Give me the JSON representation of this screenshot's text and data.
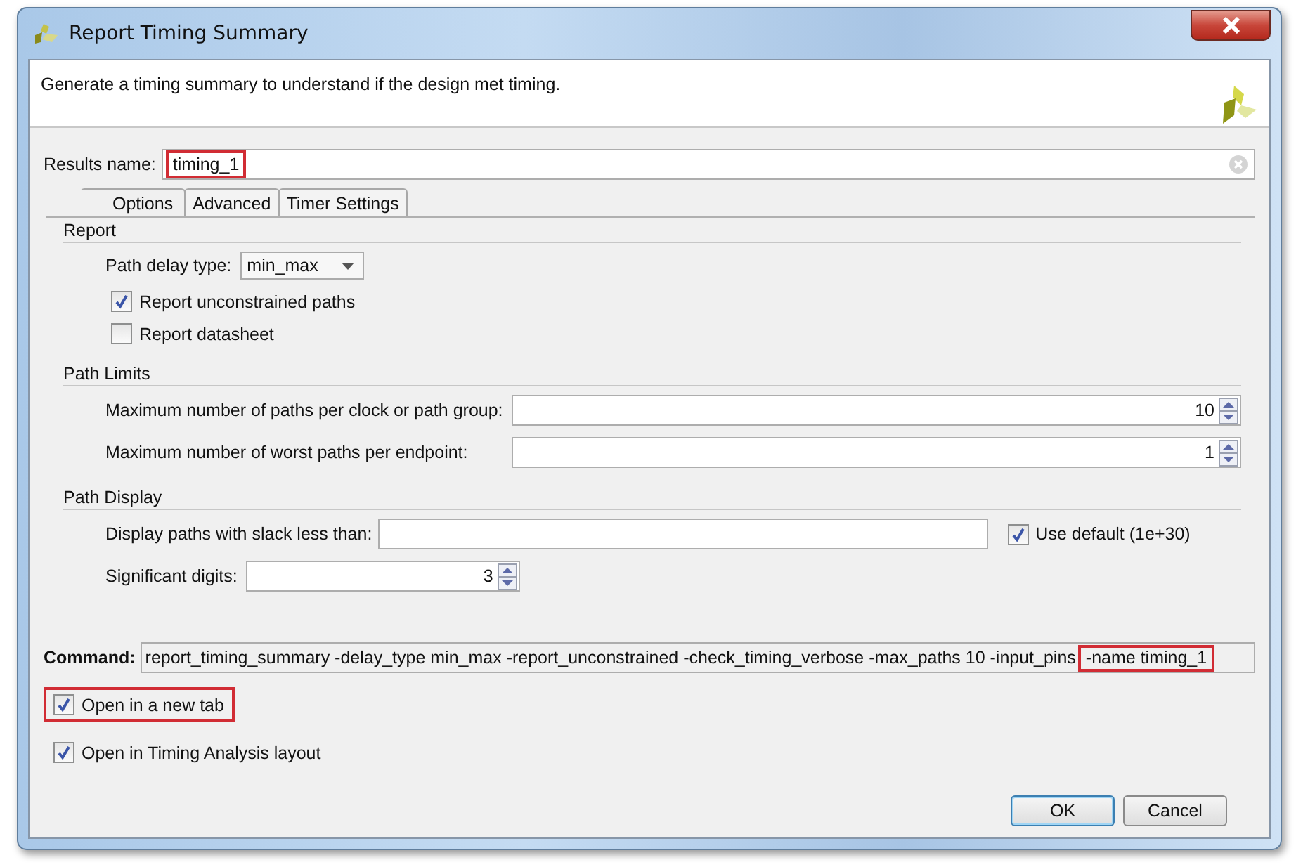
{
  "window": {
    "title": "Report Timing Summary"
  },
  "description": "Generate a timing summary to understand if the design met timing.",
  "results_name": {
    "label": "Results name:",
    "value": "timing_1",
    "highlighted": true
  },
  "tabs": [
    {
      "label": "Options",
      "selected": true
    },
    {
      "label": "Advanced",
      "selected": false
    },
    {
      "label": "Timer Settings",
      "selected": false
    }
  ],
  "sections": [
    {
      "title": "Report",
      "rows": [
        {
          "kind": "dropdown",
          "label": "Path delay type:",
          "value": "min_max"
        },
        {
          "kind": "checkbox",
          "label": "Report unconstrained paths",
          "checked": true
        },
        {
          "kind": "checkbox",
          "label": "Report datasheet",
          "checked": false
        }
      ]
    },
    {
      "title": "Path Limits",
      "rows": [
        {
          "kind": "spinner",
          "label": "Maximum number of paths per clock or path group:",
          "value": "10"
        },
        {
          "kind": "spinner",
          "label": "Maximum number of worst paths per endpoint:",
          "value": "1"
        }
      ]
    },
    {
      "title": "Path Display",
      "rows": [
        {
          "kind": "slack",
          "label": "Display paths with slack less than:",
          "checkbox_label": "Use default (1e+30)",
          "checked": true
        },
        {
          "kind": "stepper",
          "label": "Significant digits:",
          "value": "3"
        }
      ]
    }
  ],
  "command": {
    "label": "Command:",
    "text": "report_timing_summary -delay_type min_max -report_unconstrained -check_timing_verbose -max_paths 10 -input_pins",
    "highlighted_text": "-name timing_1"
  },
  "options": [
    {
      "label": "Open in a new tab",
      "checked": true,
      "highlighted": true
    },
    {
      "label": "Open in Timing Analysis layout",
      "checked": true,
      "highlighted": false
    }
  ],
  "buttons": [
    {
      "label": "OK",
      "default": true
    },
    {
      "label": "Cancel",
      "default": false
    }
  ]
}
